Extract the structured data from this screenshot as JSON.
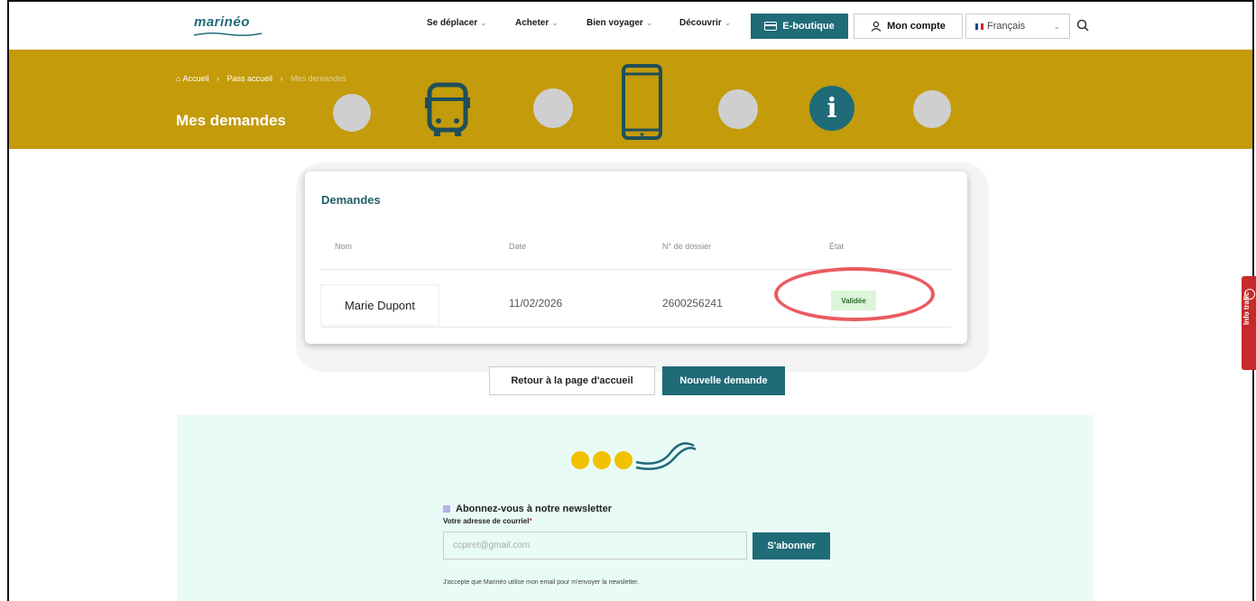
{
  "header": {
    "logo": "marinéo",
    "nav": [
      {
        "label": "Se déplacer"
      },
      {
        "label": "Acheter"
      },
      {
        "label": "Bien voyager"
      },
      {
        "label": "Découvrir"
      }
    ],
    "eshop_label": "E-boutique",
    "account_label": "Mon compte",
    "language": "Français"
  },
  "banner": {
    "breadcrumb": [
      "Accueil",
      "Pass accueil",
      "Mes demandes"
    ],
    "title": "Mes demandes",
    "info_glyph": "i"
  },
  "requests": {
    "title": "Demandes",
    "columns": [
      "Nom",
      "Date",
      "N° de dossier",
      "État"
    ],
    "rows": [
      {
        "name": "Marie Dupont",
        "date": "11/02/2026",
        "file_number": "2600256241",
        "status": "Validée"
      }
    ]
  },
  "actions": {
    "back_label": "Retour à la page d'accueil",
    "new_label": "Nouvelle demande"
  },
  "newsletter": {
    "title": "Abonnez-vous à notre newsletter",
    "email_label": "Votre adresse de courriel",
    "required_mark": "*",
    "email_value": "ccpiret@gmail.com",
    "subscribe_label": "S'abonner",
    "consent": "J'accepte que Marinéo utilise mon email pour m'envoyer la newsletter."
  },
  "side_tab": {
    "label": "Info trafic"
  },
  "colors": {
    "brand_teal": "#1f6b78",
    "banner_gold": "#c39b0b",
    "status_green_bg": "#dcf5d8",
    "highlight_red": "#ea5b60",
    "trafic_red": "#c62a2a"
  }
}
